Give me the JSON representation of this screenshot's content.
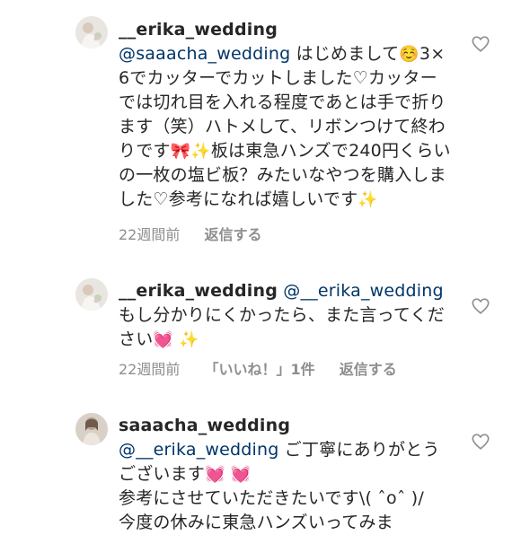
{
  "comments": [
    {
      "username": "__erika_wedding",
      "mention": "@saaacha_wedding",
      "text_1": "はじめまして",
      "emoji_1": "☺️",
      "text_2": "3×6でカッターでカットしました♡カッターでは切れ目を入れる程度であとは手で折ります（笑）ハトメして、リボンつけて終わりです",
      "emoji_2": "🎀",
      "emoji_3": "✨",
      "text_3": "板は東急ハンズで240円くらいの一枚の塩ビ板？みたいなやつを購入しました♡参考になれば嬉しいです",
      "emoji_4": "✨",
      "time": "22週間前",
      "reply_label": "返信する",
      "avatar_icon": "bride-avatar-photo",
      "like_icon": "heart-outline-icon"
    },
    {
      "username": "__erika_wedding",
      "mention": "@__erika_wedding",
      "text_1": "もし分かりにくかったら、また言ってください",
      "emoji_1": "💓",
      "emoji_2": "✨",
      "time": "22週間前",
      "likes_label": "「いいね！」1件",
      "reply_label": "返信する",
      "avatar_icon": "bride-avatar-photo",
      "like_icon": "heart-outline-icon"
    },
    {
      "username": "saaacha_wedding",
      "mention": "@__erika_wedding",
      "text_1": "ご丁寧にありがとうございます",
      "emoji_1": "💓",
      "emoji_2": "💓",
      "text_2": "参考にさせていただきたいです\\( ˆoˆ )/",
      "text_3": "今度の休みに東急ハンズいってみま",
      "avatar_icon": "person-avatar-photo",
      "like_icon": "heart-outline-icon"
    }
  ],
  "colors": {
    "text": "#262626",
    "mention": "#003569",
    "meta": "#8e8e8e",
    "heart_outline": "#8e8e8e"
  }
}
